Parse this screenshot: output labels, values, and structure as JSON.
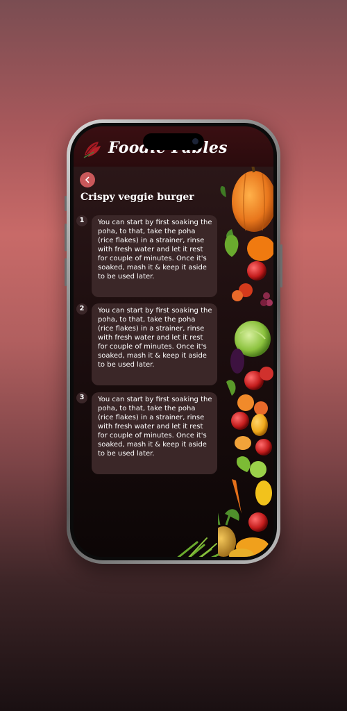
{
  "app": {
    "title": "Foodie Fables"
  },
  "recipe": {
    "title": "Crispy veggie burger",
    "steps": [
      {
        "number": "1",
        "text": "You can start by first soaking the poha, to that, take the poha (rice flakes) in a strainer, rinse with fresh water and let it rest for couple of minutes. Once it's soaked, mash it & keep it aside to be used later."
      },
      {
        "number": "2",
        "text": "You can start by first soaking the poha, to that, take the poha (rice flakes) in a strainer, rinse with fresh water and let it rest for couple of minutes. Once it's soaked, mash it & keep it aside to be used later."
      },
      {
        "number": "3",
        "text": "You can start by first soaking the poha, to that, take the poha (rice flakes) in a strainer, rinse with fresh water and let it rest for couple of minutes. Once it's soaked, mash it & keep it aside to be used later."
      }
    ]
  },
  "icons": {
    "back": "chevron-left-icon",
    "logo": "leaf-logo-icon"
  },
  "colors": {
    "accent": "#c9585a",
    "card": "#3b2728",
    "header": "#3a0f12"
  }
}
